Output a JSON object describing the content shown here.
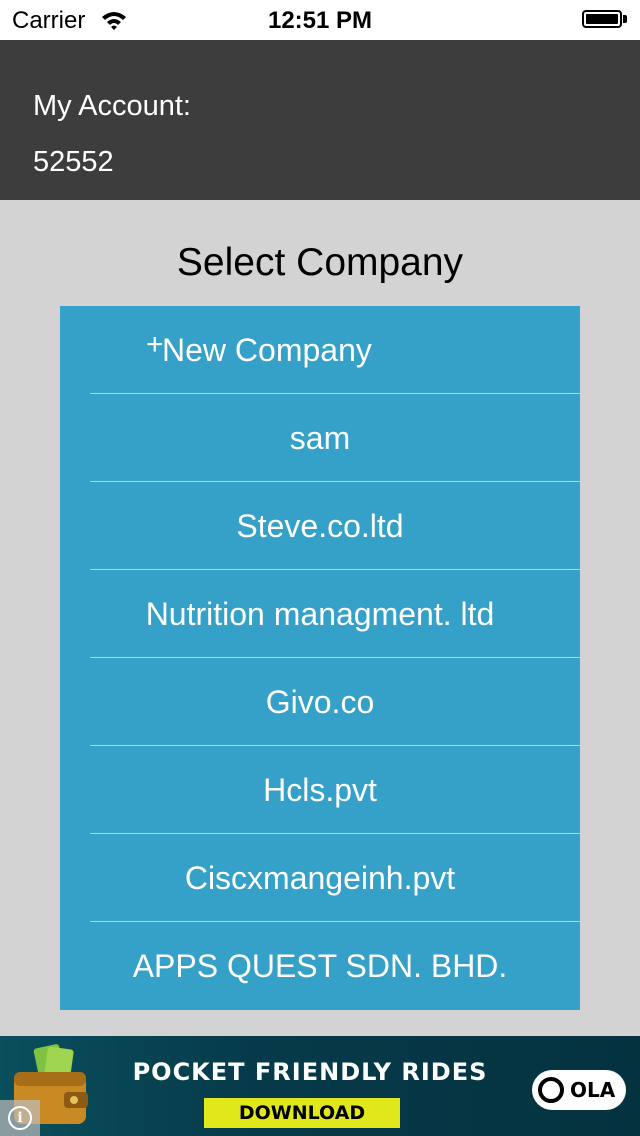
{
  "status_bar": {
    "carrier": "Carrier",
    "time": "12:51 PM"
  },
  "account": {
    "label": "My Account:",
    "number": "52552"
  },
  "title": "Select Company",
  "companies": {
    "new_label": "New Company",
    "new_symbol": "+",
    "items": [
      "sam",
      "Steve.co.ltd",
      "Nutrition managment. ltd",
      "Givo.co",
      "Hcls.pvt",
      "Ciscxmangeinh.pvt",
      "APPS QUEST SDN. BHD."
    ]
  },
  "ad": {
    "headline": "POCKET FRIENDLY RIDES",
    "cta": "DOWNLOAD",
    "brand": "OLA",
    "info_symbol": "i"
  },
  "colors": {
    "header_bg": "#3d3d3d",
    "page_bg": "#d3d3d3",
    "list_bg": "#35a0c8",
    "ad_cta": "#e0e81b"
  },
  "icons": {
    "wifi": "wifi-icon",
    "battery": "battery-icon",
    "plus": "plus-icon",
    "info": "info-icon",
    "wallet": "wallet-icon"
  }
}
